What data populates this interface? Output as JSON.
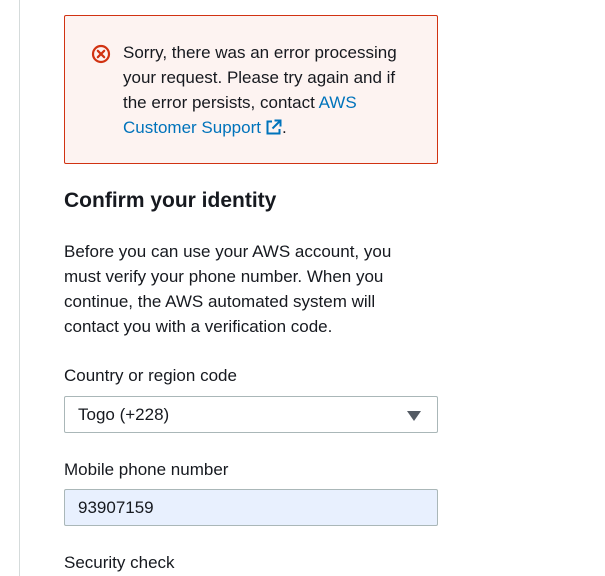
{
  "alert": {
    "icon": "error-x-circle-icon",
    "message": "Sorry, there was an error processing your request. Please try again and if the error persists, contact ",
    "link_label": "AWS Customer Support",
    "link_icon": "external-link-icon",
    "suffix": ".",
    "colors": {
      "border": "#d13212",
      "background": "#fdf3f1",
      "link": "#0073bb"
    }
  },
  "form": {
    "title": "Confirm your identity",
    "description": "Before you can use your AWS account, you must verify your phone number. When you continue, the AWS automated system will contact you with a verification code.",
    "country_label": "Country or region code",
    "country_value": "Togo (+228)",
    "phone_label": "Mobile phone number",
    "phone_value": "93907159",
    "security_label": "Security check"
  }
}
